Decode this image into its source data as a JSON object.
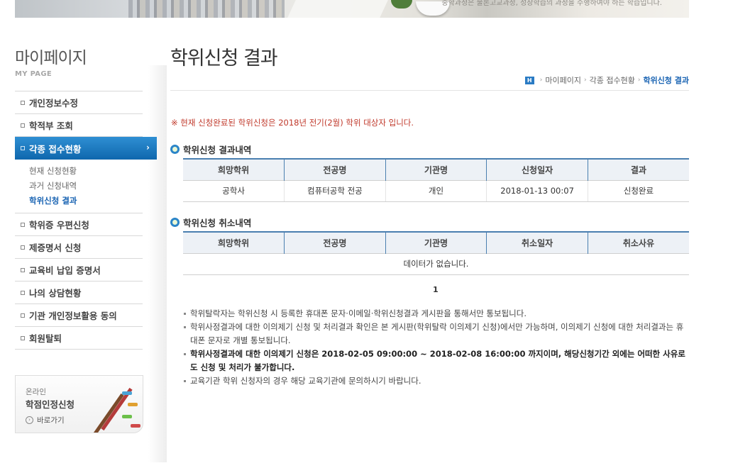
{
  "banner": {
    "caption": "중학과정은 물론고교과정, 성장학습의 과정을 수행하여야 하는 학습입니다."
  },
  "sidebar": {
    "title": "마이페이지",
    "subtitle": "MY PAGE",
    "items": [
      {
        "label": "개인정보수정"
      },
      {
        "label": "학적부 조회"
      },
      {
        "label": "각종 접수현황"
      },
      {
        "label": "학위증 우편신청"
      },
      {
        "label": "제증명서 신청"
      },
      {
        "label": "교육비 납입 증명서"
      },
      {
        "label": "나의 상담현황"
      },
      {
        "label": "기관 개인정보활용 동의"
      },
      {
        "label": "회원탈퇴"
      }
    ],
    "submenu": [
      "현재 신청현황",
      "과거 신청내역",
      "학위신청 결과"
    ],
    "promo": {
      "small": "온라인",
      "title": "학점인정신청",
      "link": "바로가기"
    }
  },
  "main": {
    "title": "학위신청 결과",
    "breadcrumb": {
      "home": "H",
      "items": [
        "마이페이지",
        "각종 접수현황",
        "학위신청 결과"
      ]
    },
    "notice": "※ 현재 신청완료된 학위신청은 2018년 전기(2월) 학위 대상자 입니다.",
    "section1": {
      "title": "학위신청 결과내역",
      "headers": [
        "희망학위",
        "전공명",
        "기관명",
        "신청일자",
        "결과"
      ],
      "row": [
        "공학사",
        "컴퓨터공학 전공",
        "개인",
        "2018-01-13 00:07",
        "신청완료"
      ]
    },
    "section2": {
      "title": "학위신청 취소내역",
      "headers": [
        "희망학위",
        "전공명",
        "기관명",
        "취소일자",
        "취소사유"
      ],
      "empty": "데이터가 없습니다."
    },
    "pager": "1",
    "info": [
      "학위탈락자는 학위신청 시 등록한 휴대폰 문자·이메일·학위신청결과 게시판을 통해서만 통보됩니다.",
      "학위사정결과에 대한 이의제기 신청 및 처리결과 확인은 본 게시판(학위탈락 이의제기 신청)에서만 가능하며, 이의제기 신청에 대한 처리결과는 휴대폰 문자로 개별 통보됩니다.",
      "학위사정결과에 대한 이의제기 신청은 2018-02-05 09:00:00 ~ 2018-02-08 16:00:00 까지이며, 해당신청기간 외에는 어떠한 사유로도 신청 및 처리가 불가합니다.",
      "교육기관 학위 신청자의 경우 해당 교육기관에 문의하시기 바랍니다."
    ]
  },
  "colors": {
    "accent": "#1a64b3",
    "active_menu": "#0f67ad",
    "notice": "#c0392b",
    "table_header_bg": "#edf1f6",
    "table_border": "#4a7fb0"
  }
}
